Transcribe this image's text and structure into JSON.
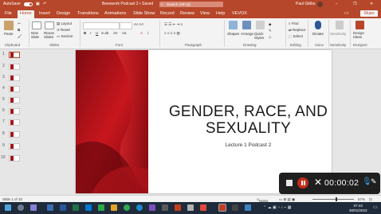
{
  "titlebar": {
    "autosave_label": "AutoSave",
    "autosave_state": "On",
    "doc_title": "Beeswork Podcast 2 • Saved",
    "search_placeholder": "Search (Alt+Q)",
    "user_name": "Paul Gibbs"
  },
  "menu": {
    "tabs": [
      "File",
      "Home",
      "Insert",
      "Design",
      "Transitions",
      "Animations",
      "Slide Show",
      "Record",
      "Review",
      "View",
      "Help",
      "VEVOX"
    ],
    "active_tab": "Home",
    "share_label": "Share"
  },
  "ribbon": {
    "clipboard": {
      "paste": "Paste",
      "group": "Clipboard"
    },
    "slides": {
      "new_slide": "New Slide",
      "reuse_slides": "Reuse Slides",
      "layout": "Layout",
      "reset": "Reset",
      "section": "Section",
      "group": "Slides"
    },
    "font": {
      "group": "Font"
    },
    "paragraph": {
      "group": "Paragraph"
    },
    "drawing": {
      "shapes": "Shapes",
      "arrange": "Arrange",
      "quick_styles": "Quick Styles",
      "group": "Drawing"
    },
    "editing": {
      "find": "Find",
      "replace": "Replace",
      "select": "Select",
      "group": "Editing"
    },
    "voice": {
      "dictate": "Dictate",
      "group": "Voice"
    },
    "sensitivity": {
      "label": "Sensitivity",
      "group": "Sensitivity"
    },
    "designer": {
      "ideas": "Design Ideas",
      "group": "Designer"
    }
  },
  "thumbnails": {
    "numbers": [
      "1",
      "2",
      "3",
      "4",
      "5",
      "6",
      "7",
      "8",
      "9",
      "10"
    ],
    "selected": "1"
  },
  "slide": {
    "title": "GENDER, RACE, AND SEXUALITY",
    "subtitle": "Lecture 1 Podcast 2",
    "accent_color": "#a4161a"
  },
  "statusbar": {
    "slide_counter": "Slide 1 of 10",
    "notes": "Notes",
    "zoom": "67%"
  },
  "recorder": {
    "elapsed": "00:00:02"
  },
  "taskbar": {
    "time": "07:43",
    "date": "30/01/2023"
  }
}
